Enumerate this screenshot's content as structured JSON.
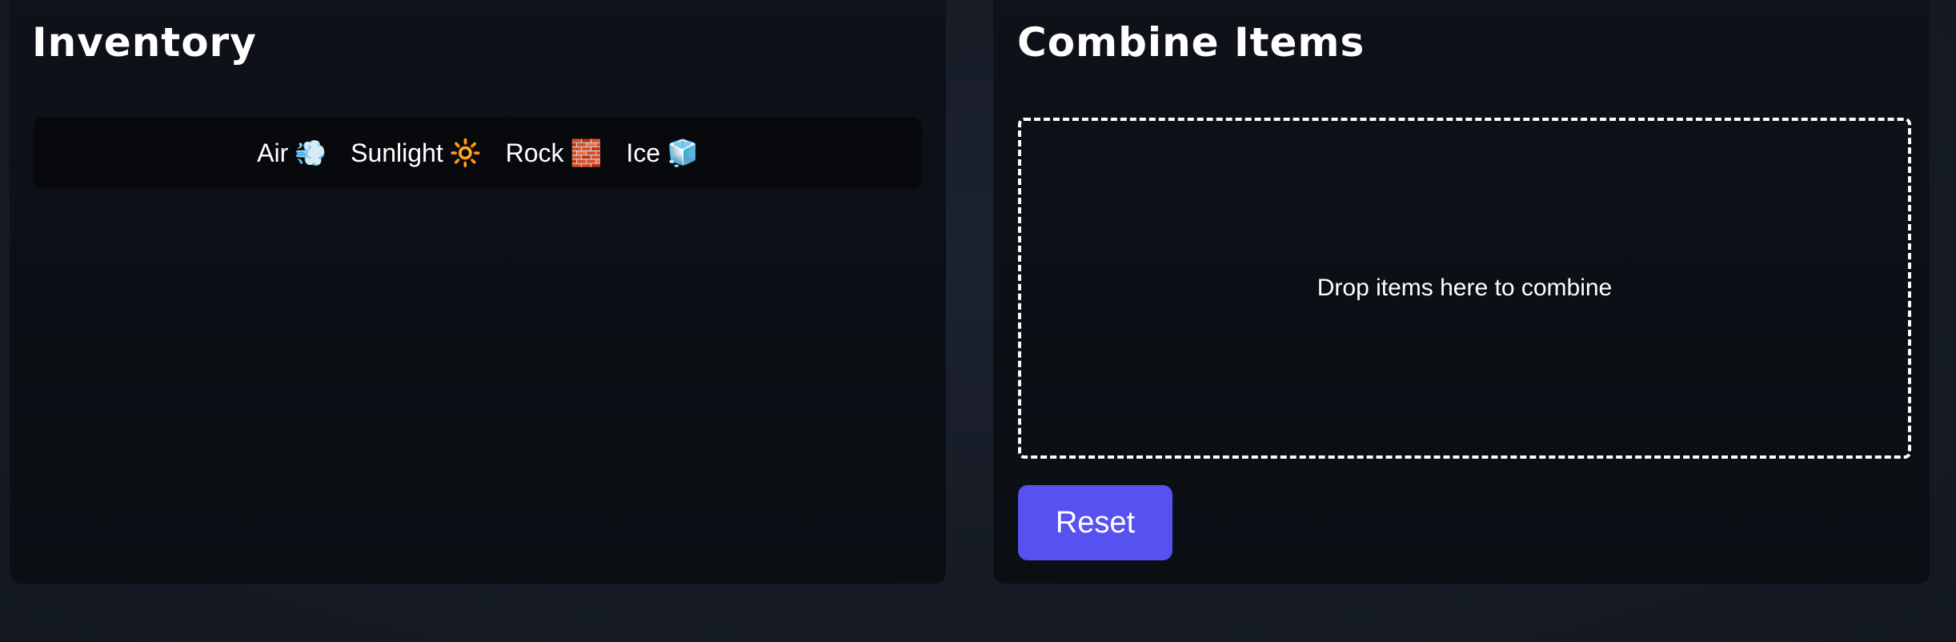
{
  "inventory": {
    "title": "Inventory",
    "items": [
      {
        "label": "Air",
        "emoji": "💨",
        "icon": "air-icon"
      },
      {
        "label": "Sunlight",
        "emoji": "🔆",
        "icon": "sunlight-icon"
      },
      {
        "label": "Rock",
        "emoji": "🧱",
        "icon": "rock-icon"
      },
      {
        "label": "Ice",
        "emoji": "🧊",
        "icon": "ice-icon"
      }
    ]
  },
  "combine": {
    "title": "Combine Items",
    "drop_hint": "Drop items here to combine",
    "reset_label": "Reset"
  },
  "colors": {
    "accent": "#5751f0",
    "panel_bg": "#0e1219",
    "page_bg": "#161b25"
  }
}
